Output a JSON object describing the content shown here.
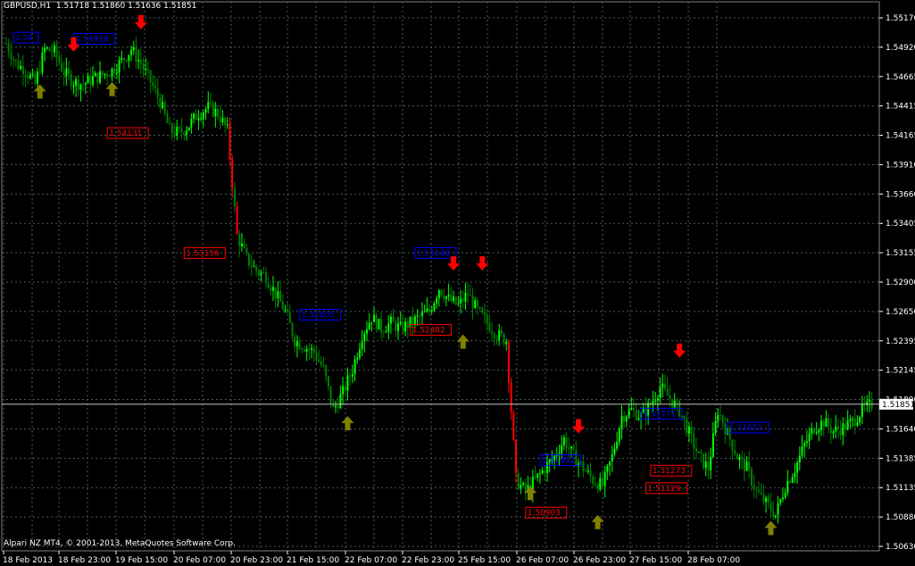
{
  "header": {
    "symbol": "GBPUSD,H1",
    "ohlc": "1.51718 1.51860 1.51636 1.51851"
  },
  "footer": {
    "copyright": "Alpari NZ MT4, © 2001-2013, MetaQuotes Software Corp."
  },
  "colors": {
    "background": "#000000",
    "grid": "#4a5a5a",
    "axis_text": "#ffffff",
    "bull": "#00ff00",
    "bear": "#ff0000",
    "blue_bar": "#0000ff",
    "green_dark": "#008000",
    "up_arrow": "#808000",
    "down_arrow": "#ff0000",
    "label_blue": "#0000ff",
    "label_red": "#ff0000",
    "current_price_line": "#c0c0c0"
  },
  "chart_data": {
    "type": "candlestick",
    "symbol": "GBPUSD",
    "timeframe": "H1",
    "current_price": "1.51851",
    "ylim": [
      1.5063,
      1.5517
    ],
    "y_ticks": [
      "1.55170",
      "1.54920",
      "1.54665",
      "1.54415",
      "1.54165",
      "1.53910",
      "1.53660",
      "1.53405",
      "1.53155",
      "1.52900",
      "1.52650",
      "1.52395",
      "1.52145",
      "1.51890",
      "1.51640",
      "1.51385",
      "1.51135",
      "1.50880",
      "1.50630"
    ],
    "x_ticks": [
      "18 Feb 2013",
      "18 Feb 23:00",
      "19 Feb 15:00",
      "20 Feb 07:00",
      "20 Feb 23:00",
      "21 Feb 15:00",
      "22 Feb 07:00",
      "22 Feb 23:00",
      "25 Feb 15:00",
      "26 Feb 07:00",
      "26 Feb 23:00",
      "27 Feb 15:00",
      "28 Feb 07:00"
    ],
    "price_path": [
      [
        0,
        1.5495
      ],
      [
        4,
        1.5478
      ],
      [
        8,
        1.5472
      ],
      [
        12,
        1.546
      ],
      [
        16,
        1.549
      ],
      [
        20,
        1.5488
      ],
      [
        24,
        1.547
      ],
      [
        28,
        1.5462
      ],
      [
        32,
        1.546
      ],
      [
        36,
        1.5465
      ],
      [
        40,
        1.5468
      ],
      [
        44,
        1.5472
      ],
      [
        48,
        1.548
      ],
      [
        52,
        1.549
      ],
      [
        56,
        1.5478
      ],
      [
        60,
        1.5462
      ],
      [
        64,
        1.5445
      ],
      [
        68,
        1.542
      ],
      [
        72,
        1.5418
      ],
      [
        76,
        1.5425
      ],
      [
        80,
        1.5435
      ],
      [
        84,
        1.544
      ],
      [
        88,
        1.5435
      ],
      [
        92,
        1.542
      ],
      [
        96,
        1.533
      ],
      [
        100,
        1.531
      ],
      [
        104,
        1.53
      ],
      [
        108,
        1.5295
      ],
      [
        112,
        1.528
      ],
      [
        116,
        1.5265
      ],
      [
        120,
        1.524
      ],
      [
        124,
        1.5235
      ],
      [
        128,
        1.523
      ],
      [
        132,
        1.5215
      ],
      [
        136,
        1.518
      ],
      [
        140,
        1.5195
      ],
      [
        144,
        1.5215
      ],
      [
        148,
        1.5245
      ],
      [
        152,
        1.526
      ],
      [
        156,
        1.525
      ],
      [
        160,
        1.5255
      ],
      [
        164,
        1.525
      ],
      [
        168,
        1.5255
      ],
      [
        172,
        1.526
      ],
      [
        176,
        1.5265
      ],
      [
        180,
        1.5285
      ],
      [
        184,
        1.5275
      ],
      [
        188,
        1.527
      ],
      [
        192,
        1.528
      ],
      [
        196,
        1.5265
      ],
      [
        200,
        1.5255
      ],
      [
        204,
        1.5245
      ],
      [
        208,
        1.524
      ],
      [
        212,
        1.512
      ],
      [
        216,
        1.511
      ],
      [
        220,
        1.512
      ],
      [
        224,
        1.513
      ],
      [
        228,
        1.514
      ],
      [
        232,
        1.5155
      ],
      [
        236,
        1.514
      ],
      [
        240,
        1.513
      ],
      [
        244,
        1.512
      ],
      [
        248,
        1.5115
      ],
      [
        252,
        1.514
      ],
      [
        256,
        1.5175
      ],
      [
        260,
        1.518
      ],
      [
        264,
        1.5175
      ],
      [
        268,
        1.5185
      ],
      [
        272,
        1.52
      ],
      [
        276,
        1.519
      ],
      [
        280,
        1.518
      ],
      [
        284,
        1.516
      ],
      [
        288,
        1.514
      ],
      [
        292,
        1.513
      ],
      [
        296,
        1.518
      ],
      [
        300,
        1.516
      ],
      [
        304,
        1.514
      ],
      [
        308,
        1.513
      ],
      [
        312,
        1.511
      ],
      [
        316,
        1.51
      ],
      [
        320,
        1.509
      ],
      [
        324,
        1.5115
      ],
      [
        328,
        1.513
      ],
      [
        332,
        1.515
      ],
      [
        336,
        1.5165
      ],
      [
        340,
        1.517
      ],
      [
        344,
        1.5162
      ],
      [
        348,
        1.5165
      ],
      [
        352,
        1.517
      ],
      [
        356,
        1.518
      ],
      [
        360,
        1.5185
      ]
    ],
    "arrows": [
      {
        "type": "up",
        "x": 14,
        "price": 1.546
      },
      {
        "type": "down",
        "x": 28,
        "price": 1.5488
      },
      {
        "type": "up",
        "x": 44,
        "price": 1.5462
      },
      {
        "type": "down",
        "x": 56,
        "price": 1.5507
      },
      {
        "type": "up",
        "x": 142,
        "price": 1.5175
      },
      {
        "type": "down",
        "x": 186,
        "price": 1.53
      },
      {
        "type": "down",
        "x": 198,
        "price": 1.53
      },
      {
        "type": "up",
        "x": 190,
        "price": 1.5245
      },
      {
        "type": "down",
        "x": 238,
        "price": 1.516
      },
      {
        "type": "up",
        "x": 218,
        "price": 1.5115
      },
      {
        "type": "up",
        "x": 246,
        "price": 1.509
      },
      {
        "type": "down",
        "x": 280,
        "price": 1.5225
      },
      {
        "type": "up",
        "x": 318,
        "price": 1.5085
      }
    ],
    "price_labels": [
      {
        "text": "1.54",
        "color": "blue",
        "x": 3,
        "price": 1.55
      },
      {
        "text": "1.54918",
        "color": "blue",
        "x": 28,
        "price": 1.5499
      },
      {
        "text": "1.54131",
        "color": "red",
        "x": 42,
        "price": 1.5418
      },
      {
        "text": "1.53156",
        "color": "red",
        "x": 74,
        "price": 1.5315
      },
      {
        "text": "1.53148",
        "color": "blue",
        "x": 170,
        "price": 1.5315
      },
      {
        "text": "1.52605",
        "color": "blue",
        "x": 122,
        "price": 1.5262
      },
      {
        "text": "1.52482",
        "color": "red",
        "x": 168,
        "price": 1.5249
      },
      {
        "text": "1.51452",
        "color": "blue",
        "x": 222,
        "price": 1.5137
      },
      {
        "text": "1.50903",
        "color": "red",
        "x": 216,
        "price": 1.5092
      },
      {
        "text": "1.51273",
        "color": "red",
        "x": 268,
        "price": 1.5128
      },
      {
        "text": "1.51129",
        "color": "red",
        "x": 266,
        "price": 1.5113
      },
      {
        "text": "1.51771",
        "color": "blue",
        "x": 264,
        "price": 1.5177
      },
      {
        "text": "1.51652",
        "color": "blue",
        "x": 300,
        "price": 1.5165
      }
    ]
  }
}
